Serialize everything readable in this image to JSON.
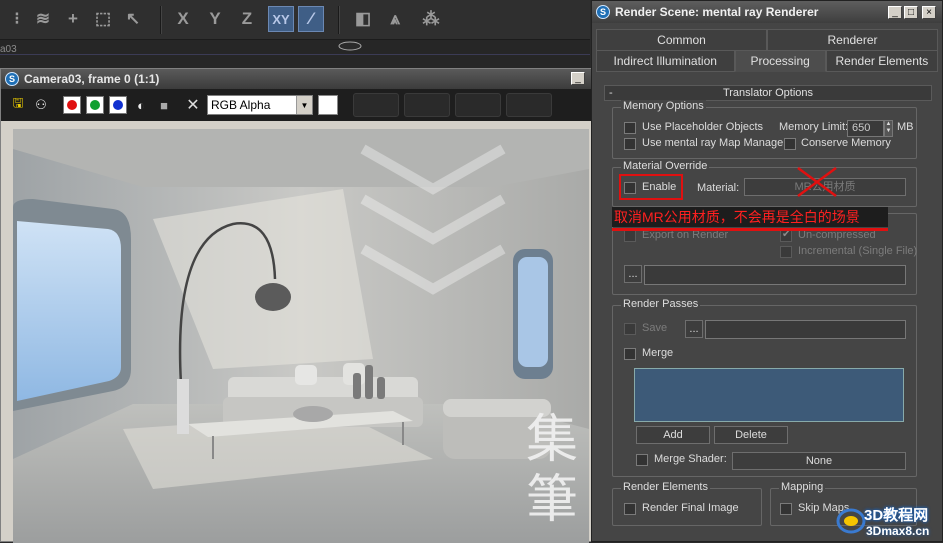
{
  "main_toolbar": {
    "axis_buttons": [
      "X",
      "Y",
      "Z",
      "XY"
    ],
    "viewport_label": "a03"
  },
  "frame_window": {
    "title": "Camera03, frame 0 (1:1)",
    "channel_select": "RGB Alpha",
    "color_buttons": [
      "#e01010",
      "#10a030",
      "#1030d0"
    ],
    "watermark": "集\n筆"
  },
  "dialog": {
    "title": "Render Scene: mental ray Renderer",
    "tabs_row1": [
      "Common",
      "Renderer"
    ],
    "tabs_row2": [
      "Indirect Illumination",
      "Processing",
      "Render Elements"
    ],
    "selected_tab": "Processing",
    "rollout": {
      "toggle": "-",
      "title": "Translator Options"
    },
    "memory_options": {
      "title": "Memory Options",
      "use_placeholder": "Use Placeholder Objects",
      "memory_limit_label": "Memory Limit:",
      "memory_limit_value": "650",
      "memory_unit": "MB",
      "use_map_manager": "Use mental ray Map Manager",
      "conserve_memory": "Conserve Memory"
    },
    "material_override": {
      "title": "Material Override",
      "enable": "Enable",
      "material_label": "Material:",
      "material_value": "MR公用材质"
    },
    "export": {
      "export_on_render": "Export on Render",
      "un_compressed": "Un-compressed",
      "incremental": "Incremental (Single File)",
      "browse": "..."
    },
    "render_passes": {
      "title": "Render Passes",
      "save": "Save",
      "browse": "...",
      "merge": "Merge",
      "add": "Add",
      "delete": "Delete",
      "merge_shader": "Merge Shader:",
      "merge_shader_value": "None"
    },
    "render_elements": {
      "title": "Render Elements",
      "render_final_image": "Render Final Image"
    },
    "mapping": {
      "title": "Mapping",
      "skip_maps": "Skip Maps"
    }
  },
  "annotation": {
    "text": "取消MR公用材质，不会再是全白的场景",
    "color": "#e01010"
  },
  "site_logo": {
    "line1": "3D教程网",
    "line2": "3Dmax8.cn"
  }
}
